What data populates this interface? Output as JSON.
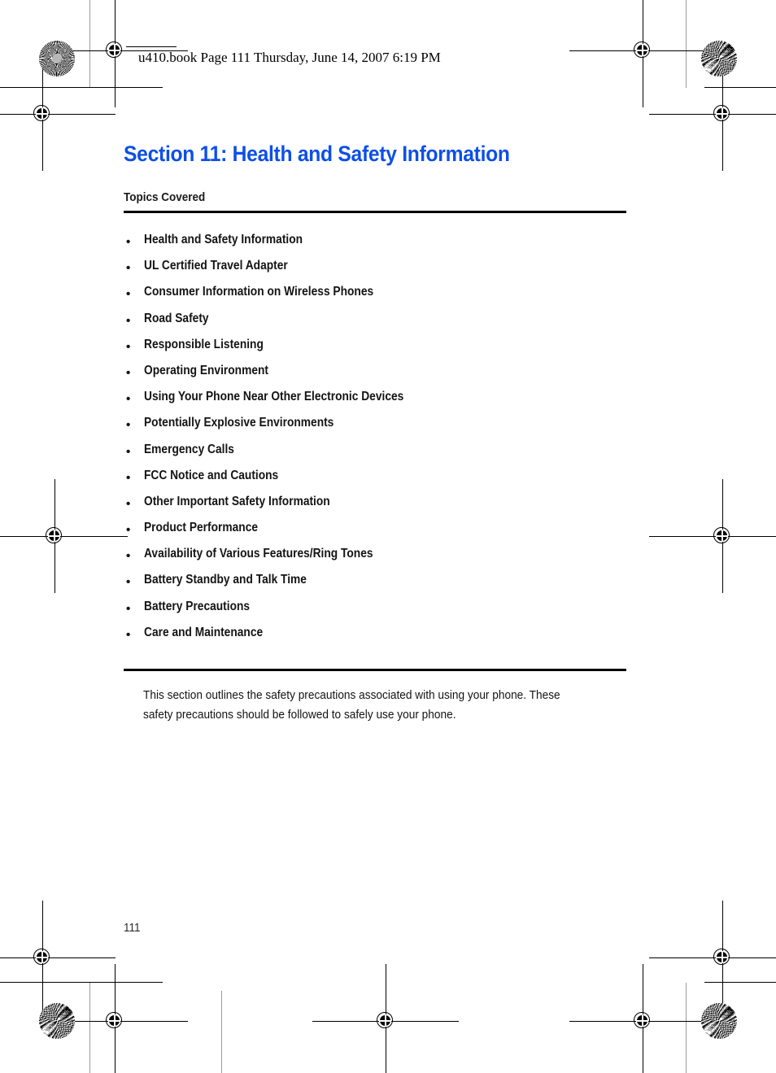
{
  "page": {
    "running_header": "u410.book  Page 111  Thursday, June 14, 2007  6:19 PM",
    "folio": "111",
    "title": "Section 11: Health and Safety Information",
    "title_color": "#0D4FE8",
    "subheading": "Topics Covered"
  },
  "topics": [
    {
      "bullet": "•",
      "label": "Health and Safety Information"
    },
    {
      "bullet": "•",
      "label": "UL Certified Travel Adapter"
    },
    {
      "bullet": "•",
      "label": "Consumer Information on Wireless Phones"
    },
    {
      "bullet": "•",
      "label": "Road Safety"
    },
    {
      "bullet": "•",
      "label": "Responsible Listening"
    },
    {
      "bullet": "•",
      "label": "Operating Environment"
    },
    {
      "bullet": "•",
      "label": "Using Your Phone Near Other Electronic Devices"
    },
    {
      "bullet": "•",
      "label": "Potentially Explosive Environments"
    },
    {
      "bullet": "•",
      "label": "Emergency Calls"
    },
    {
      "bullet": "•",
      "label": "FCC Notice and Cautions"
    },
    {
      "bullet": "•",
      "label": "Other Important Safety Information"
    },
    {
      "bullet": "•",
      "label": "Product Performance"
    },
    {
      "bullet": "•",
      "label": "Availability of Various Features/Ring Tones"
    },
    {
      "bullet": "•",
      "label": "Battery Standby and Talk Time"
    },
    {
      "bullet": "•",
      "label": "Battery Precautions"
    },
    {
      "bullet": "•",
      "label": "Care and Maintenance"
    }
  ],
  "body": {
    "line1": "This section outlines the safety precautions associated with using your phone. These",
    "line2": "safety precautions should be followed to safely use your phone."
  },
  "print_marks": {
    "registration_label": "registration-target",
    "density_patch_label": "halftone-density-patch"
  }
}
